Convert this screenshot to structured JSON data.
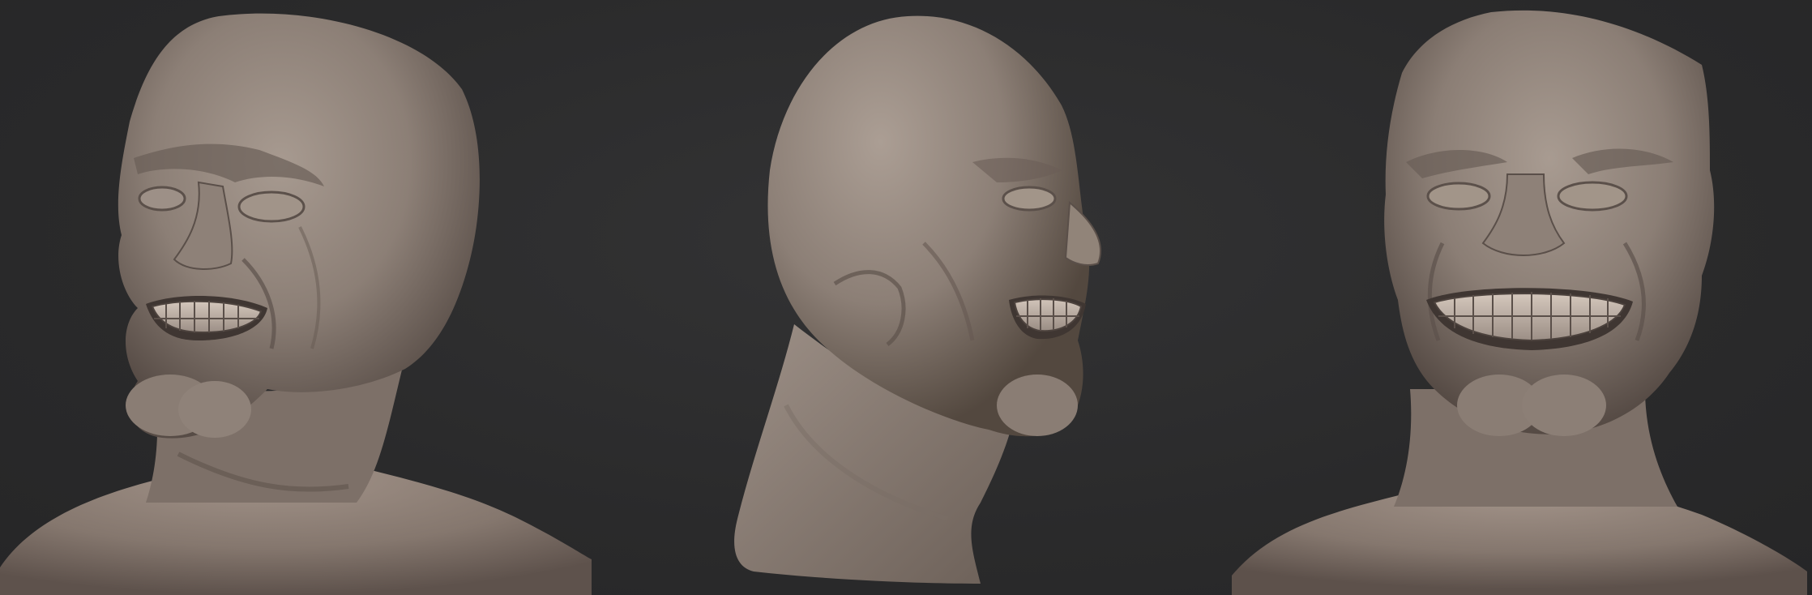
{
  "scene": {
    "description_shown": "",
    "views": [
      {
        "id": "three-quarter-left",
        "label": ""
      },
      {
        "id": "profile-right",
        "label": ""
      },
      {
        "id": "front",
        "label": ""
      }
    ],
    "colors": {
      "background": "#2b2b2c",
      "clay_base": "#8f8178",
      "clay_light": "#b3a59b",
      "clay_shadow": "#4c423d",
      "teeth": "#c9bcb1"
    }
  }
}
